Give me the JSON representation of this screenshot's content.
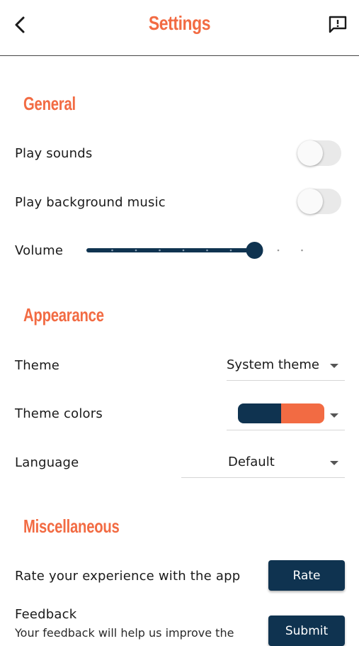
{
  "header": {
    "title": "Settings",
    "back_icon": "chevron-left-icon",
    "feedback_icon": "report-feedback-icon"
  },
  "general": {
    "title": "General",
    "play_sounds": {
      "label": "Play sounds",
      "on": false
    },
    "background_music": {
      "label": "Play background music",
      "on": false
    },
    "volume": {
      "label": "Volume",
      "level": 0.7,
      "steps": 10
    }
  },
  "appearance": {
    "title": "Appearance",
    "theme": {
      "label": "Theme",
      "value": "System theme"
    },
    "theme_colors": {
      "label": "Theme colors",
      "primary": "#0f3350",
      "accent": "#f26b43"
    },
    "language": {
      "label": "Language",
      "value": "Default"
    }
  },
  "misc": {
    "title": "Miscellaneous",
    "rate": {
      "label": "Rate your experience with the app",
      "button": "Rate"
    },
    "feedback": {
      "label": "Feedback",
      "description": "Your feedback will help us improve the",
      "button": "Submit"
    }
  },
  "colors": {
    "accent": "#f26b43",
    "primary": "#0f3350"
  }
}
